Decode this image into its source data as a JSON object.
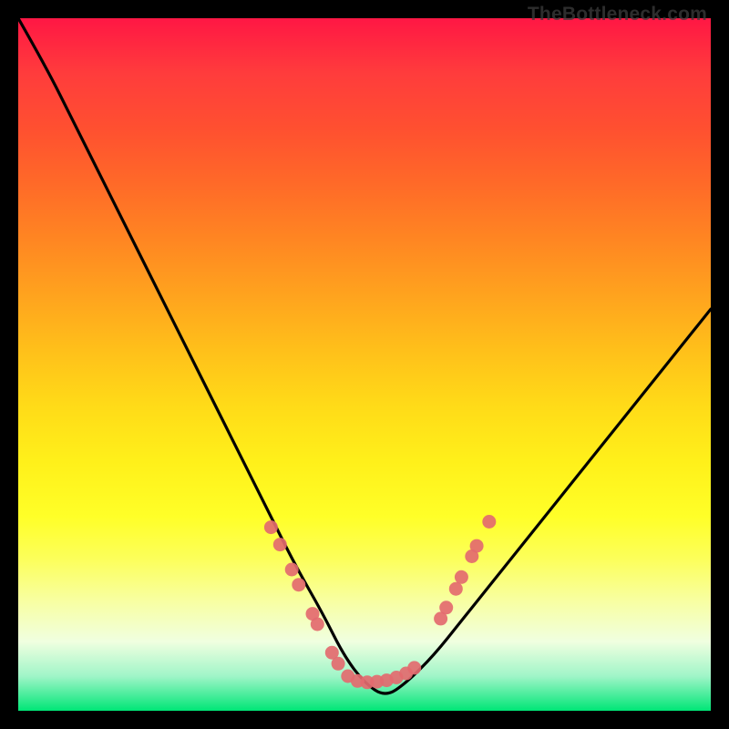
{
  "watermark": "TheBottleneck.com",
  "chart_data": {
    "type": "line",
    "title": "",
    "xlabel": "",
    "ylabel": "",
    "xlim": [
      0,
      100
    ],
    "ylim": [
      0,
      100
    ],
    "grid": false,
    "legend": false,
    "curve_percent": {
      "x": [
        0,
        4,
        8,
        12,
        16,
        20,
        24,
        28,
        32,
        36,
        40,
        44,
        47,
        50,
        53,
        56,
        60,
        64,
        68,
        72,
        76,
        80,
        84,
        88,
        92,
        96,
        100
      ],
      "y": [
        100,
        93,
        85,
        77,
        69,
        61,
        53,
        45,
        37,
        29,
        21,
        14,
        8,
        4,
        2,
        4,
        8,
        13,
        18,
        23,
        28,
        33,
        38,
        43,
        48,
        53,
        58
      ]
    },
    "dot_clusters_percent": [
      {
        "x": 36.5,
        "y": 26.5
      },
      {
        "x": 37.8,
        "y": 24.0
      },
      {
        "x": 39.5,
        "y": 20.4
      },
      {
        "x": 40.5,
        "y": 18.2
      },
      {
        "x": 42.5,
        "y": 14.0
      },
      {
        "x": 43.2,
        "y": 12.5
      },
      {
        "x": 45.3,
        "y": 8.4
      },
      {
        "x": 46.2,
        "y": 6.8
      },
      {
        "x": 47.6,
        "y": 5.0
      },
      {
        "x": 49.0,
        "y": 4.3
      },
      {
        "x": 50.4,
        "y": 4.1
      },
      {
        "x": 51.8,
        "y": 4.2
      },
      {
        "x": 53.2,
        "y": 4.4
      },
      {
        "x": 54.6,
        "y": 4.8
      },
      {
        "x": 56.0,
        "y": 5.4
      },
      {
        "x": 57.2,
        "y": 6.2
      },
      {
        "x": 61.0,
        "y": 13.3
      },
      {
        "x": 61.8,
        "y": 14.9
      },
      {
        "x": 63.2,
        "y": 17.6
      },
      {
        "x": 64.0,
        "y": 19.3
      },
      {
        "x": 65.5,
        "y": 22.3
      },
      {
        "x": 66.2,
        "y": 23.8
      },
      {
        "x": 68.0,
        "y": 27.3
      }
    ],
    "colors": {
      "curve": "#000000",
      "dots": "#e36a6f"
    }
  }
}
